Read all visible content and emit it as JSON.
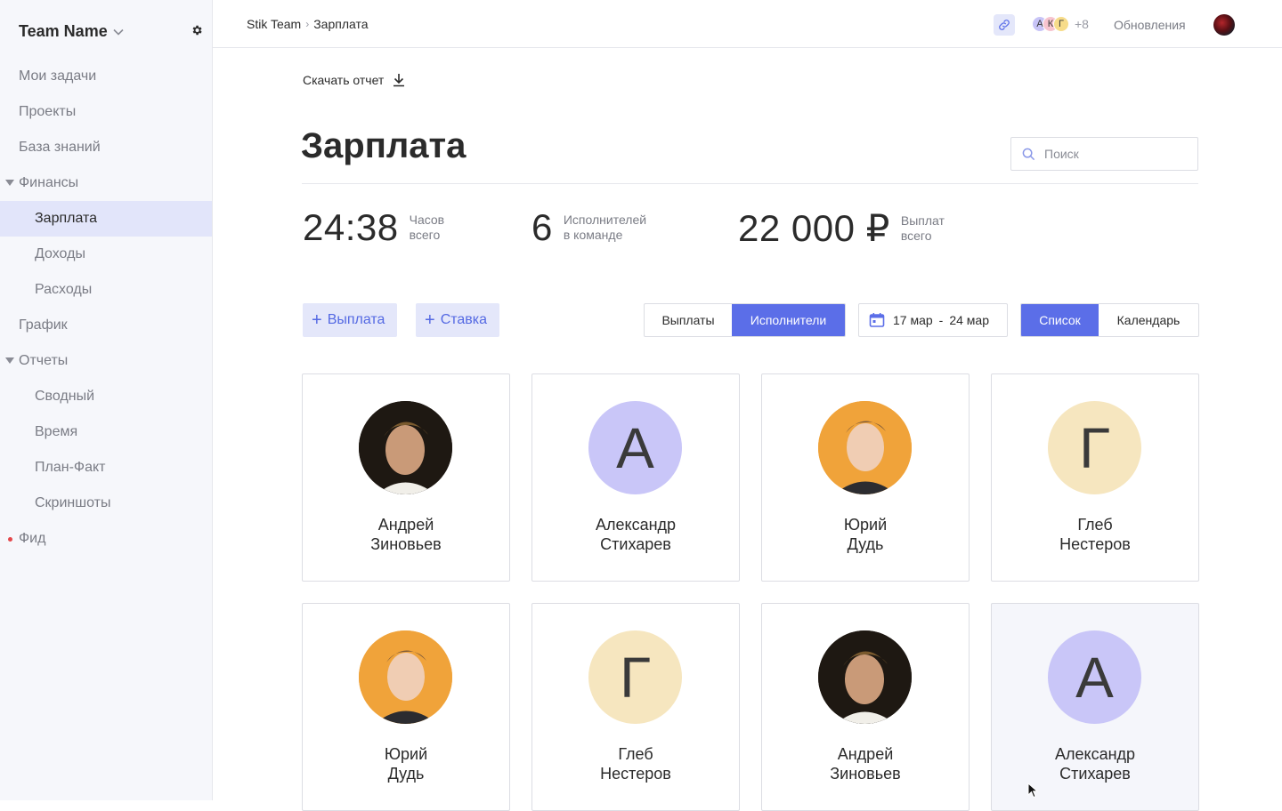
{
  "sidebar": {
    "team_name": "Team Name",
    "items": [
      {
        "label": "Мои задачи"
      },
      {
        "label": "Проекты"
      },
      {
        "label": "База знаний"
      },
      {
        "label": "Финансы"
      },
      {
        "label": "Зарплата"
      },
      {
        "label": "Доходы"
      },
      {
        "label": "Расходы"
      },
      {
        "label": "График"
      },
      {
        "label": "Отчеты"
      },
      {
        "label": "Сводный"
      },
      {
        "label": "Время"
      },
      {
        "label": "План-Факт"
      },
      {
        "label": "Скриншоты"
      },
      {
        "label": "Фид"
      }
    ],
    "active_item": "Зарплата"
  },
  "header": {
    "breadcrumb": [
      "Stik Team",
      "Зарплата"
    ],
    "members": [
      {
        "initial": "А",
        "color": "#c8c4f7"
      },
      {
        "initial": "К",
        "color": "#f7c4cf"
      },
      {
        "initial": "Г",
        "color": "#f7dc8a"
      }
    ],
    "members_more": "+8",
    "updates_label": "Обновления"
  },
  "main": {
    "download_label": "Скачать отчет",
    "title": "Зарплата",
    "search_placeholder": "Поиск",
    "stats": [
      {
        "value": "24:38",
        "label_1": "Часов",
        "label_2": "всего"
      },
      {
        "value": "6",
        "label_1": "Исполнителей",
        "label_2": "в команде"
      },
      {
        "value": "22 000 ₽",
        "label_1": "Выплат",
        "label_2": "всего"
      }
    ],
    "add_payment_label": "Выплата",
    "add_rate_label": "Ставка",
    "view_tabs": [
      "Выплаты",
      "Исполнители"
    ],
    "view_tab_active": "Исполнители",
    "date_from": "17 мар",
    "date_to": "24 мар",
    "mode_tabs": [
      "Список",
      "Календарь"
    ],
    "mode_tab_active": "Список",
    "people": [
      {
        "first": "Андрей",
        "last": "Зиновьев",
        "avatar": "photo",
        "initial": ""
      },
      {
        "first": "Александр",
        "last": "Стихарев",
        "avatar": "initial",
        "initial": "А",
        "color": "#c9c6f8"
      },
      {
        "first": "Юрий",
        "last": "Дудь",
        "avatar": "photo",
        "initial": ""
      },
      {
        "first": "Глеб",
        "last": "Нестеров",
        "avatar": "initial",
        "initial": "Г",
        "color": "#f6e6bf"
      },
      {
        "first": "Юрий",
        "last": "Дудь",
        "avatar": "photo",
        "initial": ""
      },
      {
        "first": "Глеб",
        "last": "Нестеров",
        "avatar": "initial",
        "initial": "Г",
        "color": "#f6e6bf"
      },
      {
        "first": "Андрей",
        "last": "Зиновьев",
        "avatar": "photo",
        "initial": ""
      },
      {
        "first": "Александр",
        "last": "Стихарев",
        "avatar": "initial",
        "initial": "А",
        "color": "#c9c6f8"
      }
    ]
  },
  "colors": {
    "accent": "#5b6ee8",
    "accent_light": "#e4e7fa",
    "feed_dot": "#e4474a"
  }
}
